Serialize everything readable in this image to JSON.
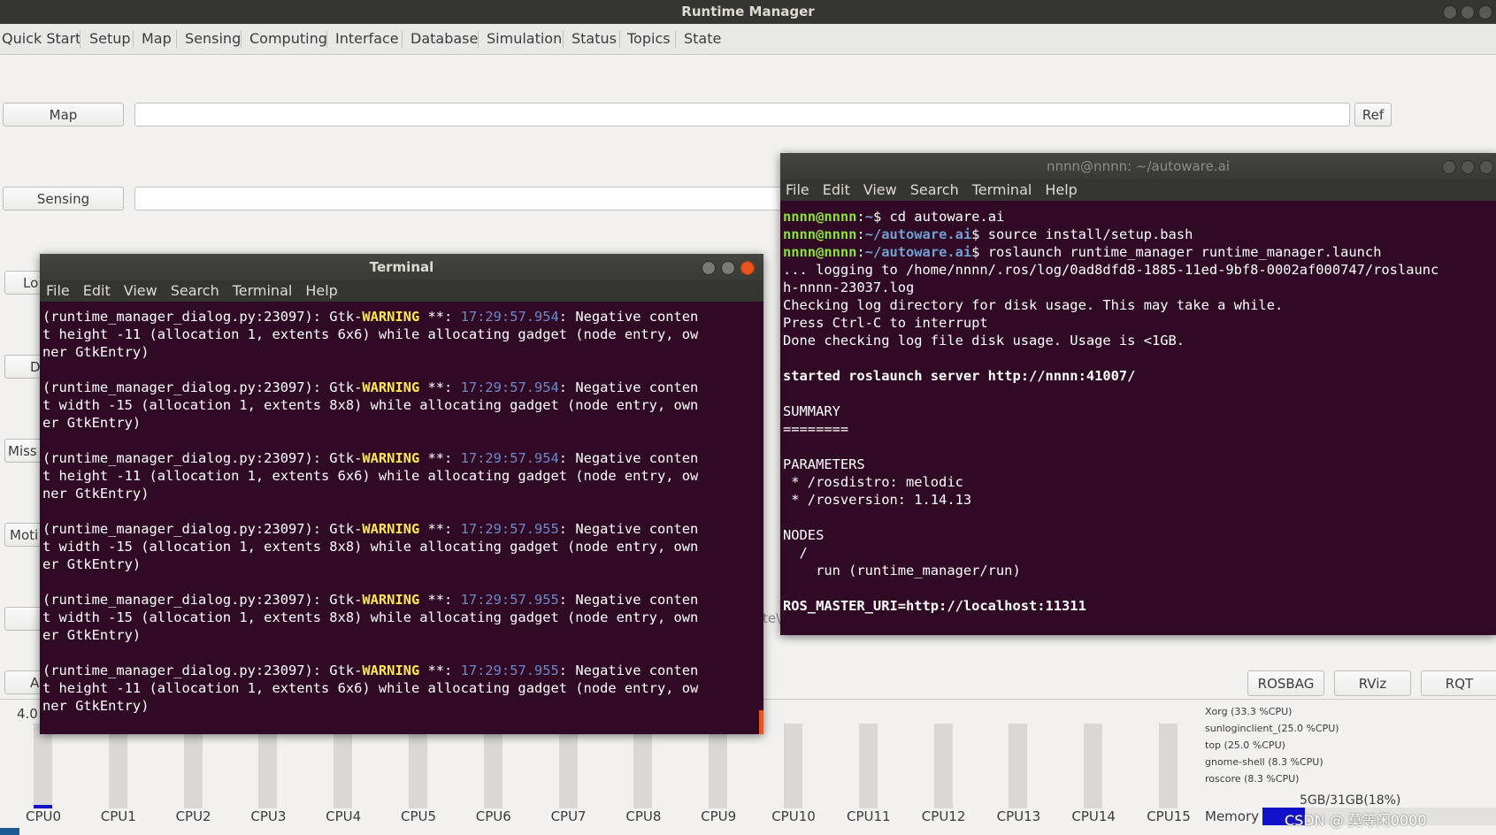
{
  "main_window": {
    "title": "Runtime Manager",
    "tabs": [
      "Quick Start",
      "Setup",
      "Map",
      "Sensing",
      "Computing",
      "Interface",
      "Database",
      "Simulation",
      "Status",
      "Topics",
      "State"
    ],
    "map_button": "Map",
    "ref_button": "Ref",
    "sensing_button": "Sensing",
    "partial_buttons": [
      "Lo",
      "D",
      "Miss",
      "Moti",
      "A"
    ],
    "partial_text": "te\\",
    "rosbag_button": "ROSBAG",
    "rviz_button": "RViz",
    "rqt_button": "RQT",
    "cpu_value": "4.0",
    "cpu_labels": [
      "CPU0",
      "CPU1",
      "CPU2",
      "CPU3",
      "CPU4",
      "CPU5",
      "CPU6",
      "CPU7",
      "CPU8",
      "CPU9",
      "CPU10",
      "CPU11",
      "CPU12",
      "CPU13",
      "CPU14",
      "CPU15"
    ],
    "processes": [
      "Xorg (33.3 %CPU)",
      "sunloginclient_(25.0 %CPU)",
      "top (25.0 %CPU)",
      "gnome-shell (8.3 %CPU)",
      "roscore (8.3 %CPU)"
    ],
    "memory_label": "Memory",
    "memory_value": "5GB/31GB(18%)",
    "memory_fraction": 0.18,
    "watermark": "CSDN @ 莫等闲0000"
  },
  "terminal_left": {
    "title": "Terminal",
    "menu": [
      "File",
      "Edit",
      "View",
      "Search",
      "Terminal",
      "Help"
    ],
    "entries": [
      {
        "ts": "17:29:57.954",
        "l2": "t height -11 (allocation 1, extents 6x6) while allocating gadget (node entry, ow",
        "l3": "ner GtkEntry)"
      },
      {
        "ts": "17:29:57.954",
        "l2": "t width -15 (allocation 1, extents 8x8) while allocating gadget (node entry, own",
        "l3": "er GtkEntry)"
      },
      {
        "ts": "17:29:57.954",
        "l2": "t height -11 (allocation 1, extents 6x6) while allocating gadget (node entry, ow",
        "l3": "ner GtkEntry)"
      },
      {
        "ts": "17:29:57.955",
        "l2": "t width -15 (allocation 1, extents 8x8) while allocating gadget (node entry, own",
        "l3": "er GtkEntry)"
      },
      {
        "ts": "17:29:57.955",
        "l2": "t width -15 (allocation 1, extents 8x8) while allocating gadget (node entry, own",
        "l3": "er GtkEntry)"
      },
      {
        "ts": "17:29:57.955",
        "l2": "t height -11 (allocation 1, extents 6x6) while allocating gadget (node entry, ow",
        "l3": "ner GtkEntry)"
      }
    ],
    "prefix": "(runtime_manager_dialog.py:23097): Gtk-",
    "warning": "WARNING",
    "stars": " **: ",
    "suffix": ": Negative conten"
  },
  "terminal_right": {
    "title": "nnnn@nnnn: ~/autoware.ai",
    "menu": [
      "File",
      "Edit",
      "View",
      "Search",
      "Terminal",
      "Help"
    ],
    "user": "nnnn@nnnn",
    "path1": "~",
    "cmd1": "$ cd autoware.ai",
    "path2": "~/autoware.ai",
    "cmd2": "$ source install/setup.bash",
    "cmd3": "$ roslaunch runtime_manager runtime_manager.launch",
    "out": [
      "... logging to /home/nnnn/.ros/log/0ad8dfd8-1885-11ed-9bf8-0002af000747/roslaunc",
      "h-nnnn-23037.log",
      "Checking log directory for disk usage. This may take a while.",
      "Press Ctrl-C to interrupt",
      "Done checking log file disk usage. Usage is <1GB."
    ],
    "started": "started roslaunch server http://nnnn:41007/",
    "summary": "SUMMARY",
    "underline": "========",
    "parameters": "PARAMETERS",
    "param1": " * /rosdistro: melodic",
    "param2": " * /rosversion: 1.14.13",
    "nodes": "NODES",
    "node_root": "  /",
    "node_run": "    run (runtime_manager/run)",
    "master": "ROS_MASTER_URI=http://localhost:11311"
  }
}
